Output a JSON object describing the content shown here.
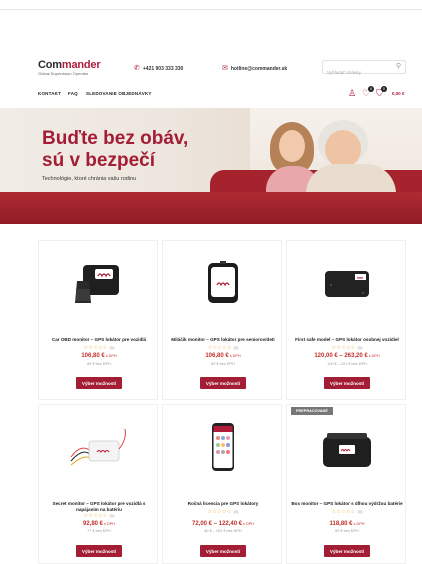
{
  "header": {
    "logo_main_a": "Com",
    "logo_main_b": "mander",
    "logo_sub": "Global Supervision Operator",
    "phone": "+421 903 333 330",
    "email": "hotline@commander.sk",
    "search_placeholder": "Vyhľadať stránky"
  },
  "nav": {
    "items": [
      "KONTAKT",
      "FAQ",
      "SLEDOVANIE OBJEDNÁVKY"
    ],
    "wishlist_count": "0",
    "cart_count": "0",
    "cart_total": "0,00 €"
  },
  "hero": {
    "title_line1": "Buďte bez obáv,",
    "title_line2": "sú v bezpečí",
    "subtitle": "Technológie, ktoré chránia vašu rodinu"
  },
  "products": [
    {
      "name": "Car OBD monitor – GPS lokátor pre vozidlá",
      "stars": "☆☆☆☆☆",
      "reviews": "(0)",
      "price": "106,80 €",
      "vat": "s DPH",
      "price_novat": "89 € bez DPH",
      "button": "Výber možností",
      "tag": ""
    },
    {
      "name": "Miláčik monitor – GPS lokátor pre seniorov/deti",
      "stars": "☆☆☆☆☆",
      "reviews": "(0)",
      "price": "106,80 €",
      "vat": "s DPH",
      "price_novat": "89 € bez DPH",
      "button": "Výber možností",
      "tag": ""
    },
    {
      "name": "First safe model – GPS lokátor osobnej vozidiel",
      "stars": "☆☆☆☆☆",
      "reviews": "(0)",
      "price": "120,00 € – 263,20 €",
      "vat": "s DPH",
      "price_novat": "100 € – 221 € bez DPH",
      "button": "Výber možností",
      "tag": ""
    },
    {
      "name": "Secret monitor – GPS lokátor pre vozidlá s napájaním na batériu",
      "stars": "☆☆☆☆☆",
      "reviews": "(0)",
      "price": "92,80 €",
      "vat": "s DPH",
      "price_novat": "77 € bez DPH",
      "button": "Výber možností",
      "tag": ""
    },
    {
      "name": "Ročná licencia pre GPS lokátory",
      "stars": "☆☆☆☆☆",
      "reviews": "(0)",
      "price": "72,00 € – 122,40 €",
      "vat": "s DPH",
      "price_novat": "60 € – 102 € bez DPH",
      "button": "Výber možností",
      "tag": ""
    },
    {
      "name": "Box monitor – GPS lokátor s dlhou výdržou batérie",
      "stars": "☆☆☆☆☆",
      "reviews": "(0)",
      "price": "118,80 €",
      "vat": "s DPH",
      "price_novat": "99 € bez DPH",
      "button": "Výber možností",
      "tag": "PREPRACOVANÉ"
    }
  ],
  "colors": {
    "accent": "#a31d35",
    "price": "#c4302b",
    "star": "#f0a030"
  }
}
